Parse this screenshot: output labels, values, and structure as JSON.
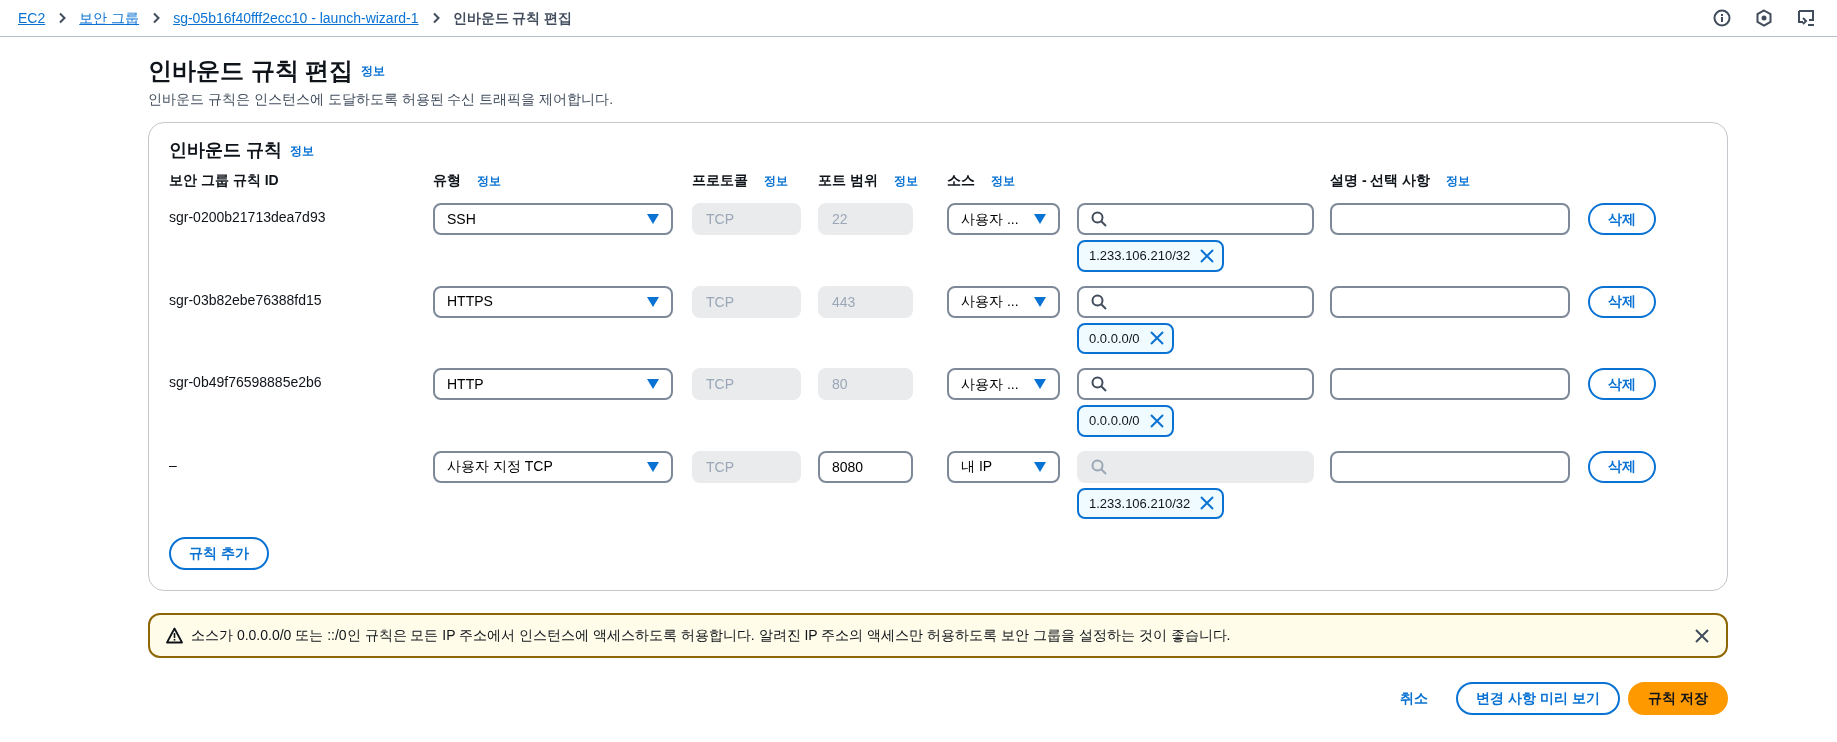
{
  "breadcrumbs": [
    {
      "label": "EC2",
      "kind": "link"
    },
    {
      "label": "보안 그룹",
      "kind": "link"
    },
    {
      "label": "sg-05b16f40fff2ecc10 - launch-wizard-1",
      "kind": "link"
    },
    {
      "label": "인바운드 규칙 편집",
      "kind": "current"
    }
  ],
  "page": {
    "title": "인바운드 규칙 편집",
    "info_link": "정보",
    "description": "인바운드 규칙은 인스턴스에 도달하도록 허용된 수신 트래픽을 제어합니다."
  },
  "rules_panel": {
    "title": "인바운드 규칙",
    "info_link": "정보",
    "columns": [
      {
        "label": "보안 그룹 규칙 ID"
      },
      {
        "label": "유형",
        "info_link": "정보"
      },
      {
        "label": "프로토콜",
        "info_link": "정보"
      },
      {
        "label": "포트 범위",
        "info_link": "정보"
      },
      {
        "label": "소스",
        "info_link": "정보"
      },
      {
        "label": "설명 - 선택 사항",
        "info_link": "정보"
      }
    ],
    "rules": [
      {
        "id": "sgr-0200b21713dea7d93",
        "type": "SSH",
        "protocol": {
          "value": "TCP",
          "disabled": true
        },
        "port": {
          "value": "22",
          "disabled": true
        },
        "source": "사용자 ...",
        "search_disabled": false,
        "chips": [
          {
            "label": "1.233.106.210/32"
          }
        ],
        "delete": "삭제"
      },
      {
        "id": "sgr-03b82ebe76388fd15",
        "type": "HTTPS",
        "protocol": {
          "value": "TCP",
          "disabled": true
        },
        "port": {
          "value": "443",
          "disabled": true
        },
        "source": "사용자 ...",
        "search_disabled": false,
        "chips": [
          {
            "label": "0.0.0.0/0"
          }
        ],
        "delete": "삭제"
      },
      {
        "id": "sgr-0b49f76598885e2b6",
        "type": "HTTP",
        "protocol": {
          "value": "TCP",
          "disabled": true
        },
        "port": {
          "value": "80",
          "disabled": true
        },
        "source": "사용자 ...",
        "search_disabled": false,
        "chips": [
          {
            "label": "0.0.0.0/0"
          }
        ],
        "delete": "삭제"
      },
      {
        "id": "–",
        "type": "사용자 지정 TCP",
        "protocol": {
          "value": "TCP",
          "disabled": true
        },
        "port": {
          "value": "8080",
          "disabled": false
        },
        "source": "내 IP",
        "search_disabled": true,
        "chips": [
          {
            "label": "1.233.106.210/32"
          }
        ],
        "delete": "삭제"
      }
    ],
    "add_button": "규칙 추가"
  },
  "alert": {
    "kind": "warning",
    "text": "소스가 0.0.0.0/0 또는 ::/0인 규칙은 모든 IP 주소에서 인스턴스에 액세스하도록 허용합니다. 알려진 IP 주소의 액세스만 허용하도록 보안 그룹을 설정하는 것이 좋습니다.",
    "dismissible": true
  },
  "footer": {
    "buttons": [
      {
        "label": "취소",
        "kind": "link"
      },
      {
        "label": "변경 사항 미리 보기",
        "kind": "secondary"
      },
      {
        "label": "규칙 저장",
        "kind": "primary"
      }
    ]
  }
}
